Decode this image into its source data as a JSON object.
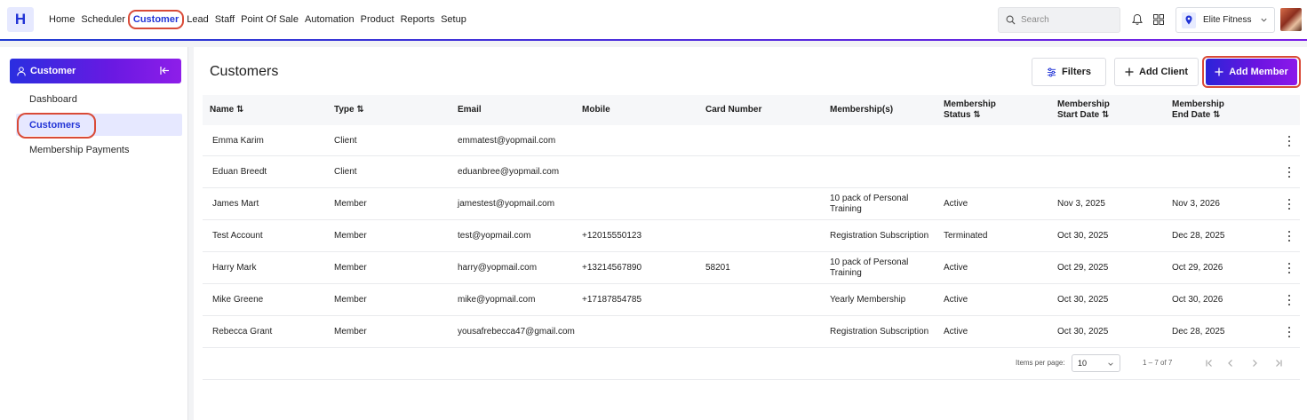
{
  "app": {
    "logo_letter": "H",
    "accent": "#2234d6",
    "highlight_ring": "#d94a37"
  },
  "nav": [
    "Home",
    "Scheduler",
    "Customer",
    "Lead",
    "Staff",
    "Point Of Sale",
    "Automation",
    "Product",
    "Reports",
    "Setup"
  ],
  "nav_active": "Customer",
  "search": {
    "placeholder": "Search"
  },
  "location": {
    "name": "Elite Fitness"
  },
  "sidebar": {
    "title": "Customer",
    "items": [
      "Dashboard",
      "Customers",
      "Membership Payments"
    ],
    "active": "Customers"
  },
  "main": {
    "title": "Customers",
    "filters_label": "Filters",
    "add_client_label": "Add Client",
    "add_member_label": "Add Member"
  },
  "table": {
    "headers": {
      "name": "Name",
      "type": "Type",
      "email": "Email",
      "mobile": "Mobile",
      "card": "Card Number",
      "memberships": "Membership(s)",
      "status_1": "Membership",
      "status_2": "Status",
      "start_1": "Membership",
      "start_2": "Start Date",
      "end_1": "Membership",
      "end_2": "End Date"
    },
    "rows": [
      {
        "name": "Emma Karim",
        "type": "Client",
        "email": "emmatest@yopmail.com",
        "mobile": "",
        "card": "",
        "membership": "",
        "status": "",
        "start": "",
        "end": ""
      },
      {
        "name": "Eduan Breedt",
        "type": "Client",
        "email": "eduanbree@yopmail.com",
        "mobile": "",
        "card": "",
        "membership": "",
        "status": "",
        "start": "",
        "end": ""
      },
      {
        "name": "James Mart",
        "type": "Member",
        "email": "jamestest@yopmail.com",
        "mobile": "",
        "card": "",
        "membership": "10 pack of Personal Training",
        "status": "Active",
        "start": "Nov 3, 2025",
        "end": "Nov 3, 2026"
      },
      {
        "name": "Test Account",
        "type": "Member",
        "email": "test@yopmail.com",
        "mobile": "+12015550123",
        "card": "",
        "membership": "Registration Subscription",
        "status": "Terminated",
        "start": "Oct 30, 2025",
        "end": "Dec 28, 2025"
      },
      {
        "name": "Harry Mark",
        "type": "Member",
        "email": "harry@yopmail.com",
        "mobile": "+13214567890",
        "card": "58201",
        "membership": "10 pack of Personal Training",
        "status": "Active",
        "start": "Oct 29, 2025",
        "end": "Oct 29, 2026"
      },
      {
        "name": "Mike Greene",
        "type": "Member",
        "email": "mike@yopmail.com",
        "mobile": "+17187854785",
        "card": "",
        "membership": "Yearly Membership",
        "status": "Active",
        "start": "Oct 30, 2025",
        "end": "Oct 30, 2026"
      },
      {
        "name": "Rebecca Grant",
        "type": "Member",
        "email": "yousafrebecca47@gmail.com",
        "mobile": "",
        "card": "",
        "membership": "Registration Subscription",
        "status": "Active",
        "start": "Oct 30, 2025",
        "end": "Dec 28, 2025"
      }
    ]
  },
  "pagination": {
    "items_label": "Items per page:",
    "per_page": "10",
    "range": "1 – 7 of 7"
  }
}
